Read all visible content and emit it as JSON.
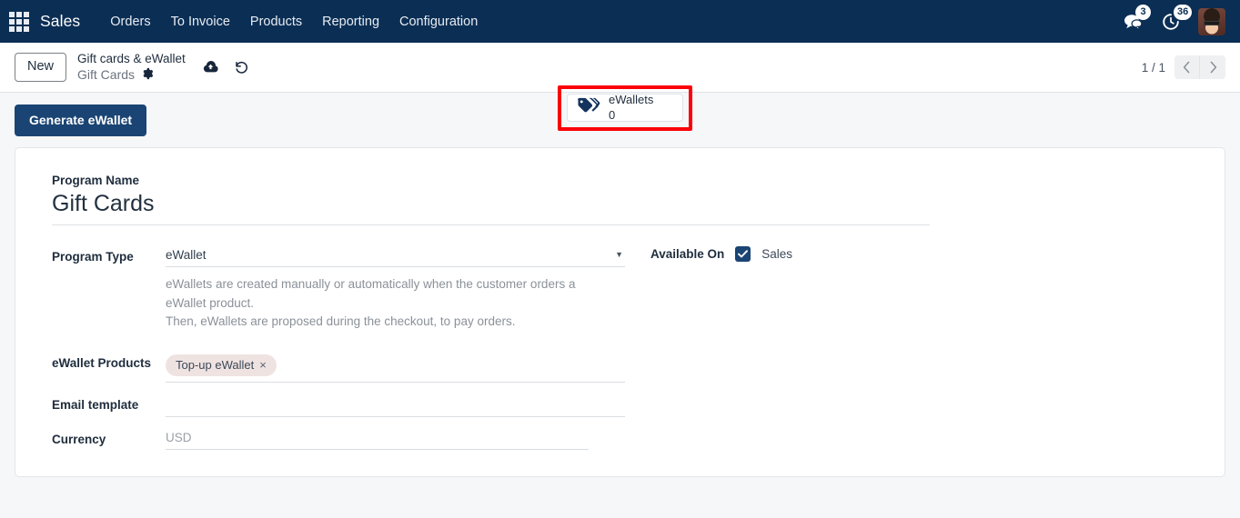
{
  "navbar": {
    "apps_icon": "apps-grid-icon",
    "brand": "Sales",
    "menu": [
      {
        "label": "Orders"
      },
      {
        "label": "To Invoice"
      },
      {
        "label": "Products"
      },
      {
        "label": "Reporting"
      },
      {
        "label": "Configuration"
      }
    ],
    "messages": {
      "icon": "messages-icon",
      "count": "3"
    },
    "activities": {
      "icon": "clock-activity-icon",
      "count": "36"
    },
    "avatar": "user-avatar",
    "bg_color": "#0b2e54"
  },
  "control_panel": {
    "new_button": "New",
    "breadcrumb_parent": "Gift cards & eWallet",
    "breadcrumb_current": "Gift Cards",
    "gear_icon": "gear-icon",
    "save_icon": "cloud-upload-save-icon",
    "discard_icon": "undo-discard-icon",
    "stat_button": {
      "icon": "tags-icon",
      "label": "eWallets",
      "value": "0",
      "highlight_color": "#fb0007"
    },
    "pager": {
      "count": "1 / 1",
      "prev_icon": "chevron-left-icon",
      "next_icon": "chevron-right-icon"
    }
  },
  "action_bar": {
    "generate_button": "Generate eWallet",
    "accent_color": "#1a4473"
  },
  "form": {
    "program_name_label": "Program Name",
    "program_name_value": "Gift Cards",
    "program_type_label": "Program Type",
    "program_type_value": "eWallet",
    "program_type_help": [
      "eWallets are created manually or automatically when the customer orders a",
      "eWallet product.",
      "Then, eWallets are proposed during the checkout, to pay orders."
    ],
    "ewallet_products_label": "eWallet Products",
    "ewallet_products_tags": [
      {
        "label": "Top-up eWallet",
        "remove_icon": "×"
      }
    ],
    "email_template_label": "Email template",
    "email_template_value": "",
    "currency_label": "Currency",
    "currency_value": "USD",
    "available_on_label": "Available On",
    "available_on_options": [
      {
        "label": "Sales",
        "checked": true
      }
    ]
  }
}
